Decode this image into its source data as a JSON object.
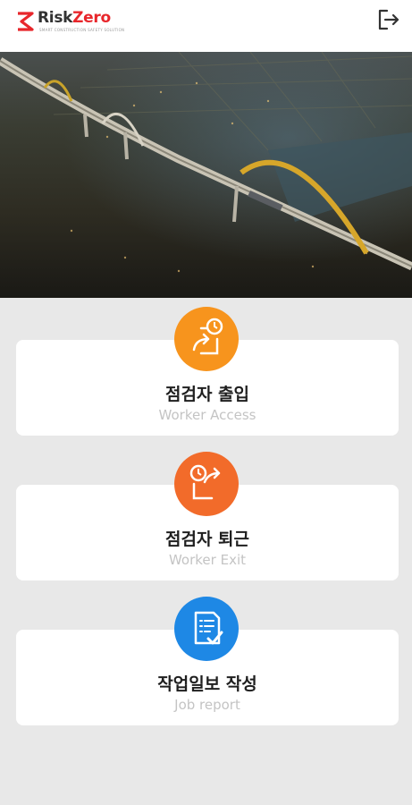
{
  "header": {
    "brand_risk": "Risk",
    "brand_zero": "Zero",
    "brand_tagline": "SMART CONSTRUCTION SAFETY SOLUTION",
    "logout_icon": "logout-icon"
  },
  "menu": [
    {
      "title": "점검자 출입",
      "subtitle": "Worker Access",
      "icon": "clock-enter-icon",
      "color": "#f7941d"
    },
    {
      "title": "점검자 퇴근",
      "subtitle": "Worker Exit",
      "icon": "clock-exit-icon",
      "color": "#f26b2a"
    },
    {
      "title": "작업일보 작성",
      "subtitle": "Job report",
      "icon": "document-check-icon",
      "color": "#1e88e5"
    }
  ]
}
